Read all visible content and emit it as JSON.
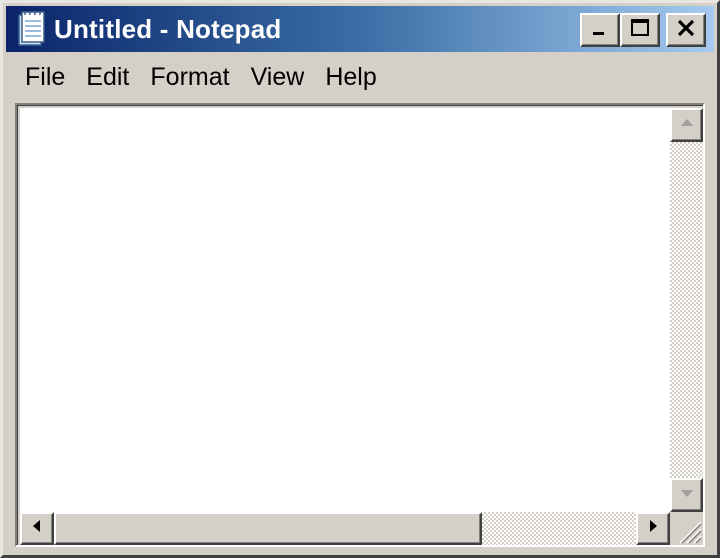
{
  "window": {
    "title": "Untitled - Notepad",
    "app_icon": "notepad-icon"
  },
  "title_buttons": {
    "minimize_icon": "minimize-icon",
    "maximize_icon": "maximize-icon",
    "close_icon": "close-icon"
  },
  "menubar": {
    "items": [
      {
        "label": "File"
      },
      {
        "label": "Edit"
      },
      {
        "label": "Format"
      },
      {
        "label": "View"
      },
      {
        "label": "Help"
      }
    ]
  },
  "editor": {
    "content": ""
  },
  "scrollbars": {
    "up_icon": "arrow-up-icon",
    "down_icon": "arrow-down-icon",
    "left_icon": "arrow-left-icon",
    "right_icon": "arrow-right-icon",
    "grip_icon": "size-grip-icon"
  },
  "colors": {
    "title_start": "#0a246a",
    "title_end": "#a6caf0",
    "face": "#d4d0c8"
  }
}
